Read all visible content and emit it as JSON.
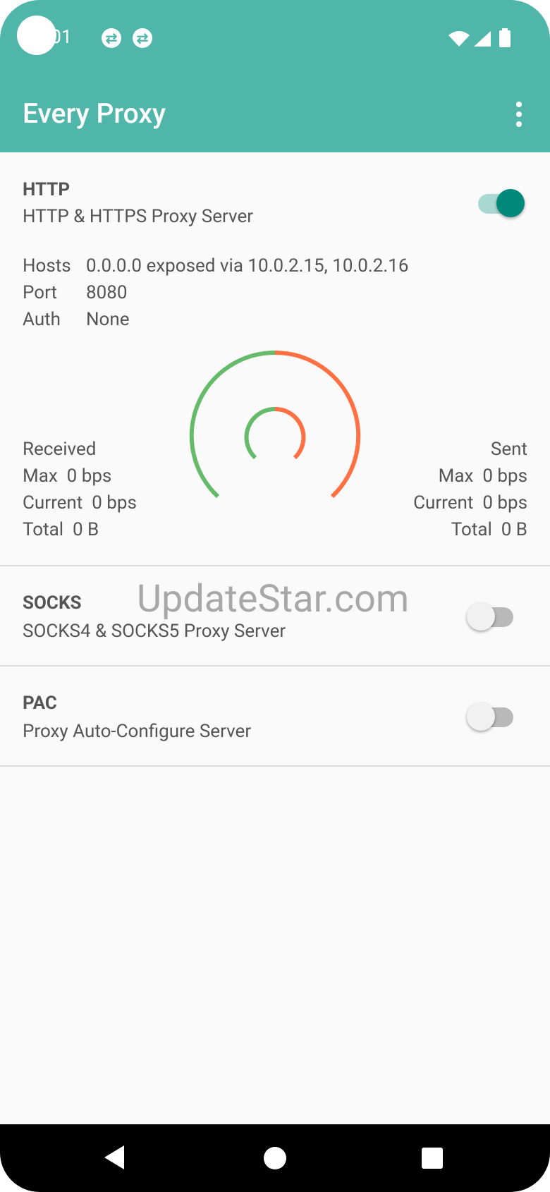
{
  "status_bar": {
    "time": "0:01"
  },
  "app": {
    "title": "Every Proxy"
  },
  "http": {
    "title": "HTTP",
    "subtitle": "HTTP & HTTPS Proxy Server",
    "enabled": true,
    "hosts_label": "Hosts",
    "hosts_value": "0.0.0.0 exposed via 10.0.2.15, 10.0.2.16",
    "port_label": "Port",
    "port_value": "8080",
    "auth_label": "Auth",
    "auth_value": "None",
    "received": {
      "heading": "Received",
      "max_label": "Max",
      "max_value": "0 bps",
      "current_label": "Current",
      "current_value": "0 bps",
      "total_label": "Total",
      "total_value": "0 B"
    },
    "sent": {
      "heading": "Sent",
      "max_label": "Max",
      "max_value": "0 bps",
      "current_label": "Current",
      "current_value": "0 bps",
      "total_label": "Total",
      "total_value": "0 B"
    }
  },
  "socks": {
    "title": "SOCKS",
    "subtitle": "SOCKS4 & SOCKS5 Proxy Server",
    "enabled": false
  },
  "pac": {
    "title": "PAC",
    "subtitle": "Proxy Auto-Configure Server",
    "enabled": false
  },
  "watermark": "UpdateStar.com",
  "colors": {
    "accent": "#51b6aa",
    "toggle_on": "#00897b",
    "gauge_received": "#66bb6a",
    "gauge_sent": "#ff7043"
  }
}
